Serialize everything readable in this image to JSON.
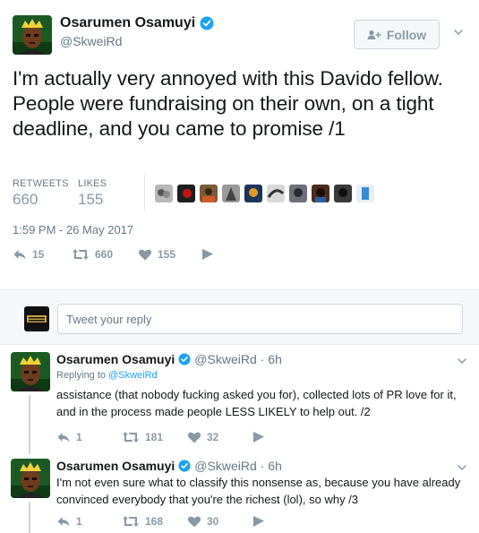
{
  "main_tweet": {
    "name": "Osarumen Osamuyi",
    "handle": "@SkweiRd",
    "follow_label": "Follow",
    "text": "I'm actually very annoyed with this Davido fellow. People were fundraising on their own, on a tight deadline, and you came to promise /1",
    "retweets_label": "RETWEETS",
    "retweets_count": "660",
    "likes_label": "LIKES",
    "likes_count": "155",
    "timestamp": "1:59 PM - 26 May 2017",
    "actions": {
      "reply_count": "15",
      "retweet_count": "660",
      "like_count": "155"
    }
  },
  "composer": {
    "placeholder": "Tweet your reply"
  },
  "replies": [
    {
      "name": "Osarumen Osamuyi",
      "handle": "@SkweiRd",
      "time": "· 6h",
      "replying_label": "Replying to",
      "replying_handle": "@SkweiRd",
      "text": "assistance (that nobody fucking asked you for), collected lots of PR love for it, and in the process made people LESS LIKELY to help out. /2",
      "reply_count": "1",
      "retweet_count": "181",
      "like_count": "32"
    },
    {
      "name": "Osarumen Osamuyi",
      "handle": "@SkweiRd",
      "time": "· 6h",
      "text": "I'm not even sure what to classify this nonsense as, because you have already convinced everybody that you're the richest (lol), so why /3",
      "reply_count": "1",
      "retweet_count": "168",
      "like_count": "30"
    }
  ],
  "colors": {
    "accent": "#1da1f2",
    "muted": "#8899a6",
    "text": "#14171a",
    "secondary": "#657786"
  },
  "icons": [
    "verified-icon",
    "follow-person-icon",
    "chevron-down-icon",
    "reply-icon",
    "retweet-icon",
    "heart-icon",
    "message-icon"
  ]
}
